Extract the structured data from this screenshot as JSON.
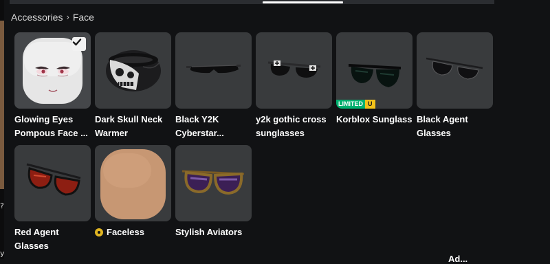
{
  "breadcrumb": {
    "parent": "Accessories",
    "separator": "›",
    "current": "Face"
  },
  "tabs": {
    "active_index": 2
  },
  "items": [
    {
      "name": "Glowing Eyes Pompous Face ...",
      "icon": "face-with-glowing-eyes",
      "selected": true
    },
    {
      "name": "Dark Skull Neck Warmer",
      "icon": "skull-neck-warmer"
    },
    {
      "name": "Black Y2K Cyberstar...",
      "icon": "black-visor-glasses"
    },
    {
      "name": "y2k gothic cross sunglasses",
      "icon": "gothic-cross-sunglasses"
    },
    {
      "name": "Korblox Sunglass",
      "icon": "korblox-sunglasses",
      "badge": {
        "limited": "LIMITED",
        "unique": "U"
      }
    },
    {
      "name": "Black Agent Glasses",
      "icon": "agent-glasses"
    },
    {
      "name": "Red Agent Glasses",
      "icon": "red-agent-glasses"
    },
    {
      "name": "Faceless",
      "icon": "faceless-head",
      "currency_icon": "robux-icon"
    },
    {
      "name": "Stylish Aviators",
      "icon": "aviator-sunglasses"
    }
  ],
  "left_edge": {
    "glyph_top": "?",
    "glyph_bottom": "y"
  },
  "bottom_text": "Ad..."
}
